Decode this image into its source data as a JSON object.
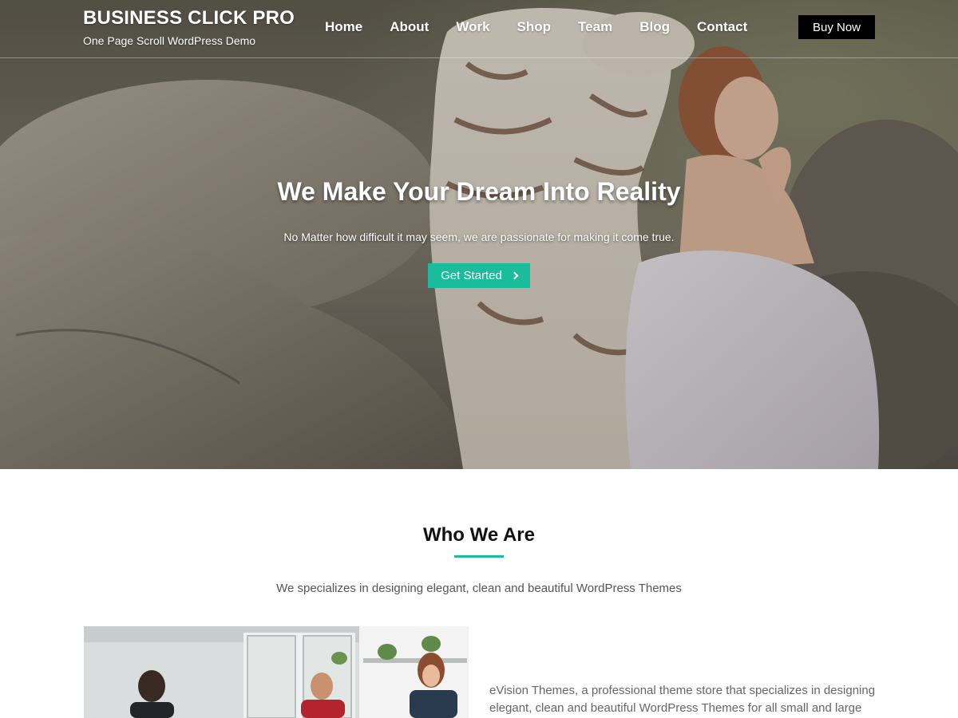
{
  "header": {
    "site_title": "BUSINESS CLICK PRO",
    "tagline": "One Page Scroll WordPress Demo",
    "nav": [
      "Home",
      "About",
      "Work",
      "Shop",
      "Team",
      "Blog",
      "Contact"
    ],
    "buy_label": "Buy Now"
  },
  "hero": {
    "heading": "We Make Your Dream Into Reality",
    "subtext": "No Matter how difficult it may seem, we are passionate for making it come true.",
    "cta_label": "Get Started"
  },
  "about": {
    "title": "Who We Are",
    "subtitle": "We specializes in designing elegant, clean and beautiful WordPress Themes",
    "body": "eVision Themes, a professional theme store that specializes in designing elegant, clean and beautiful WordPress Themes for all small and large"
  },
  "colors": {
    "accent": "#1abc9c",
    "buy_button": "#000000"
  },
  "icons": {
    "cta_icon": "chevron-right-icon"
  }
}
